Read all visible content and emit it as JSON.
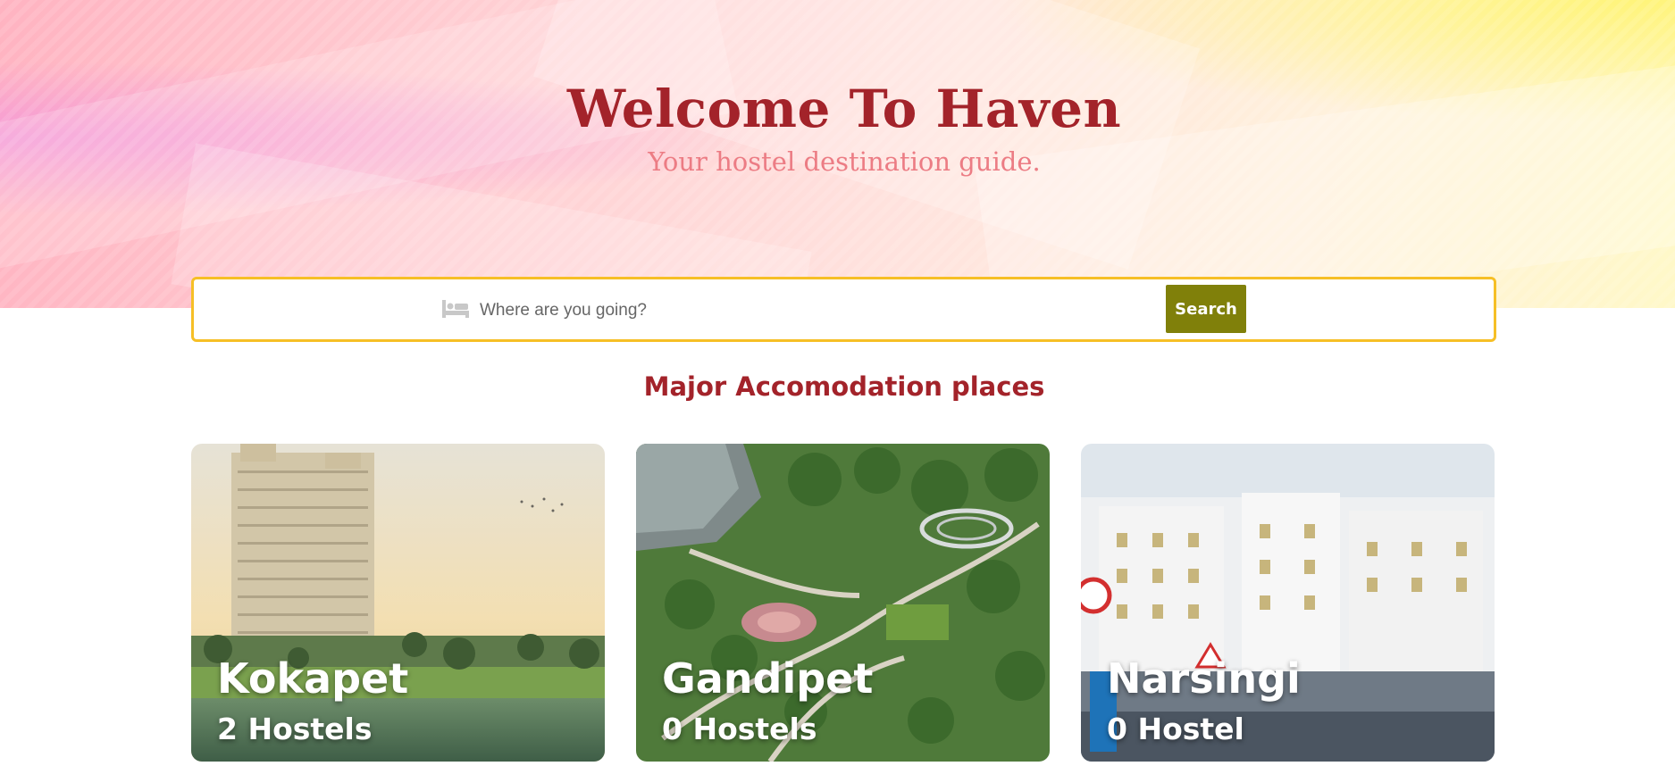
{
  "hero": {
    "title": "Welcome To Haven",
    "subtitle": "Your hostel destination guide."
  },
  "search": {
    "icon": "bed-icon",
    "placeholder": "Where are you going?",
    "button_label": "Search",
    "border_color": "#f6bf26",
    "button_color": "#80800a"
  },
  "places": {
    "title": "Major Accomodation places",
    "items": [
      {
        "name": "Kokapet",
        "count": "2 Hostels"
      },
      {
        "name": "Gandipet",
        "count": "0 Hostels"
      },
      {
        "name": "Narsingi",
        "count": "0 Hostel"
      }
    ]
  },
  "colors": {
    "title": "#a3232a",
    "subtitle": "#ec7c84"
  }
}
